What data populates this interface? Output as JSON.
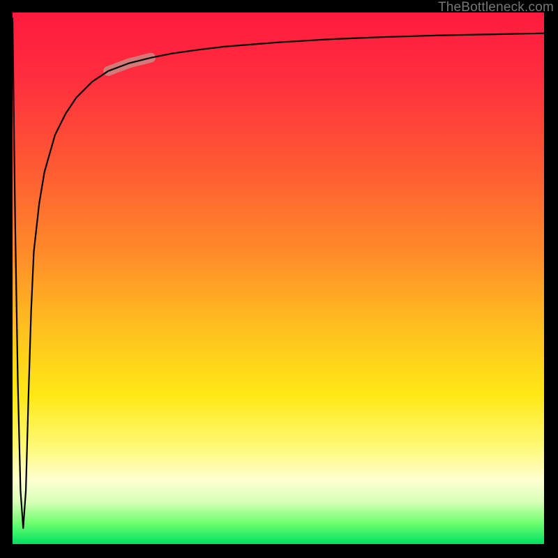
{
  "attribution": "TheBottleneck.com",
  "chart_data": {
    "type": "line",
    "title": "",
    "xlabel": "",
    "ylabel": "",
    "xlim": [
      0,
      100
    ],
    "ylim": [
      0,
      100
    ],
    "series": [
      {
        "name": "curve",
        "x": [
          0,
          0.5,
          1,
          1.5,
          2,
          2.5,
          3,
          3.5,
          4,
          5,
          6,
          8,
          10,
          12,
          15,
          18,
          22,
          26,
          30,
          35,
          40,
          50,
          60,
          70,
          80,
          90,
          100
        ],
        "y": [
          99,
          60,
          30,
          10,
          3,
          10,
          28,
          44,
          55,
          64,
          70,
          77,
          81,
          84,
          87,
          89,
          90.5,
          91.5,
          92.3,
          93,
          93.6,
          94.4,
          95,
          95.4,
          95.7,
          95.9,
          96.1
        ]
      }
    ],
    "highlight": {
      "series": "curve",
      "x_range": [
        18,
        26
      ],
      "color": "#c98b85"
    }
  }
}
